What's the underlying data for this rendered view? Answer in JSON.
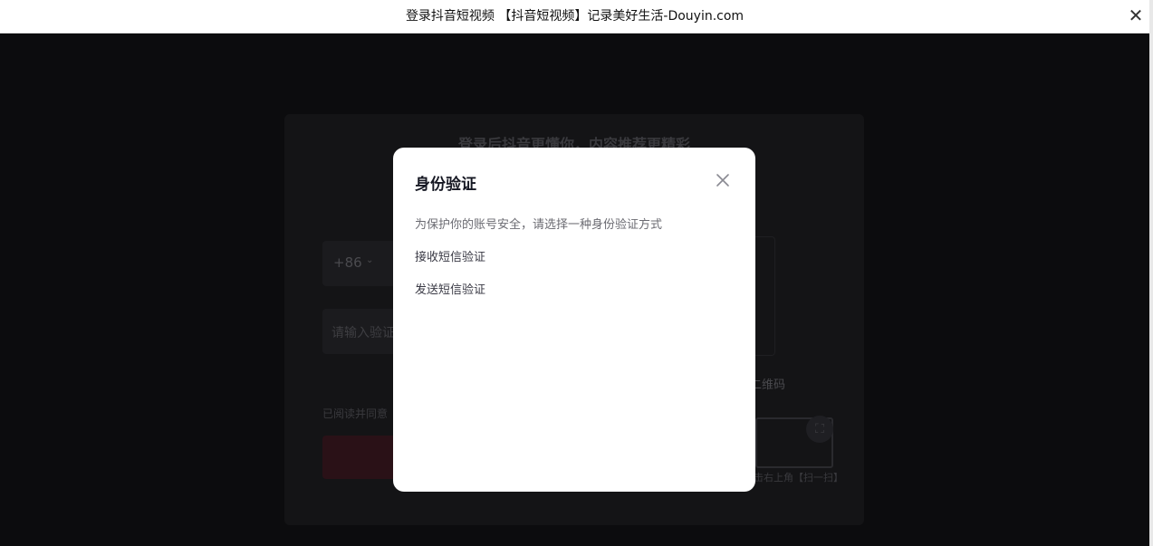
{
  "window": {
    "title": "登录抖音短视频 【抖音短视频】记录美好生活-Douyin.com",
    "close_glyph": "✕"
  },
  "login_card": {
    "headline": "登录后抖音更懂你，内容推荐更精彩",
    "phone_prefix": "+86",
    "code_placeholder": "请输入验证",
    "agreement_text": "已阅读并同意",
    "qr_label": "二维码",
    "scan_tip": "击右上角【扫一扫】"
  },
  "modal": {
    "title": "身份验证",
    "description": "为保护你的账号安全，请选择一种身份验证方式",
    "options": [
      {
        "label": "接收短信验证"
      },
      {
        "label": "发送短信验证"
      }
    ]
  },
  "colors": {
    "overlay": "#0b0b0d",
    "modal_bg": "#ffffff",
    "title_text": "#161823",
    "muted_text": "#6b6b72"
  }
}
